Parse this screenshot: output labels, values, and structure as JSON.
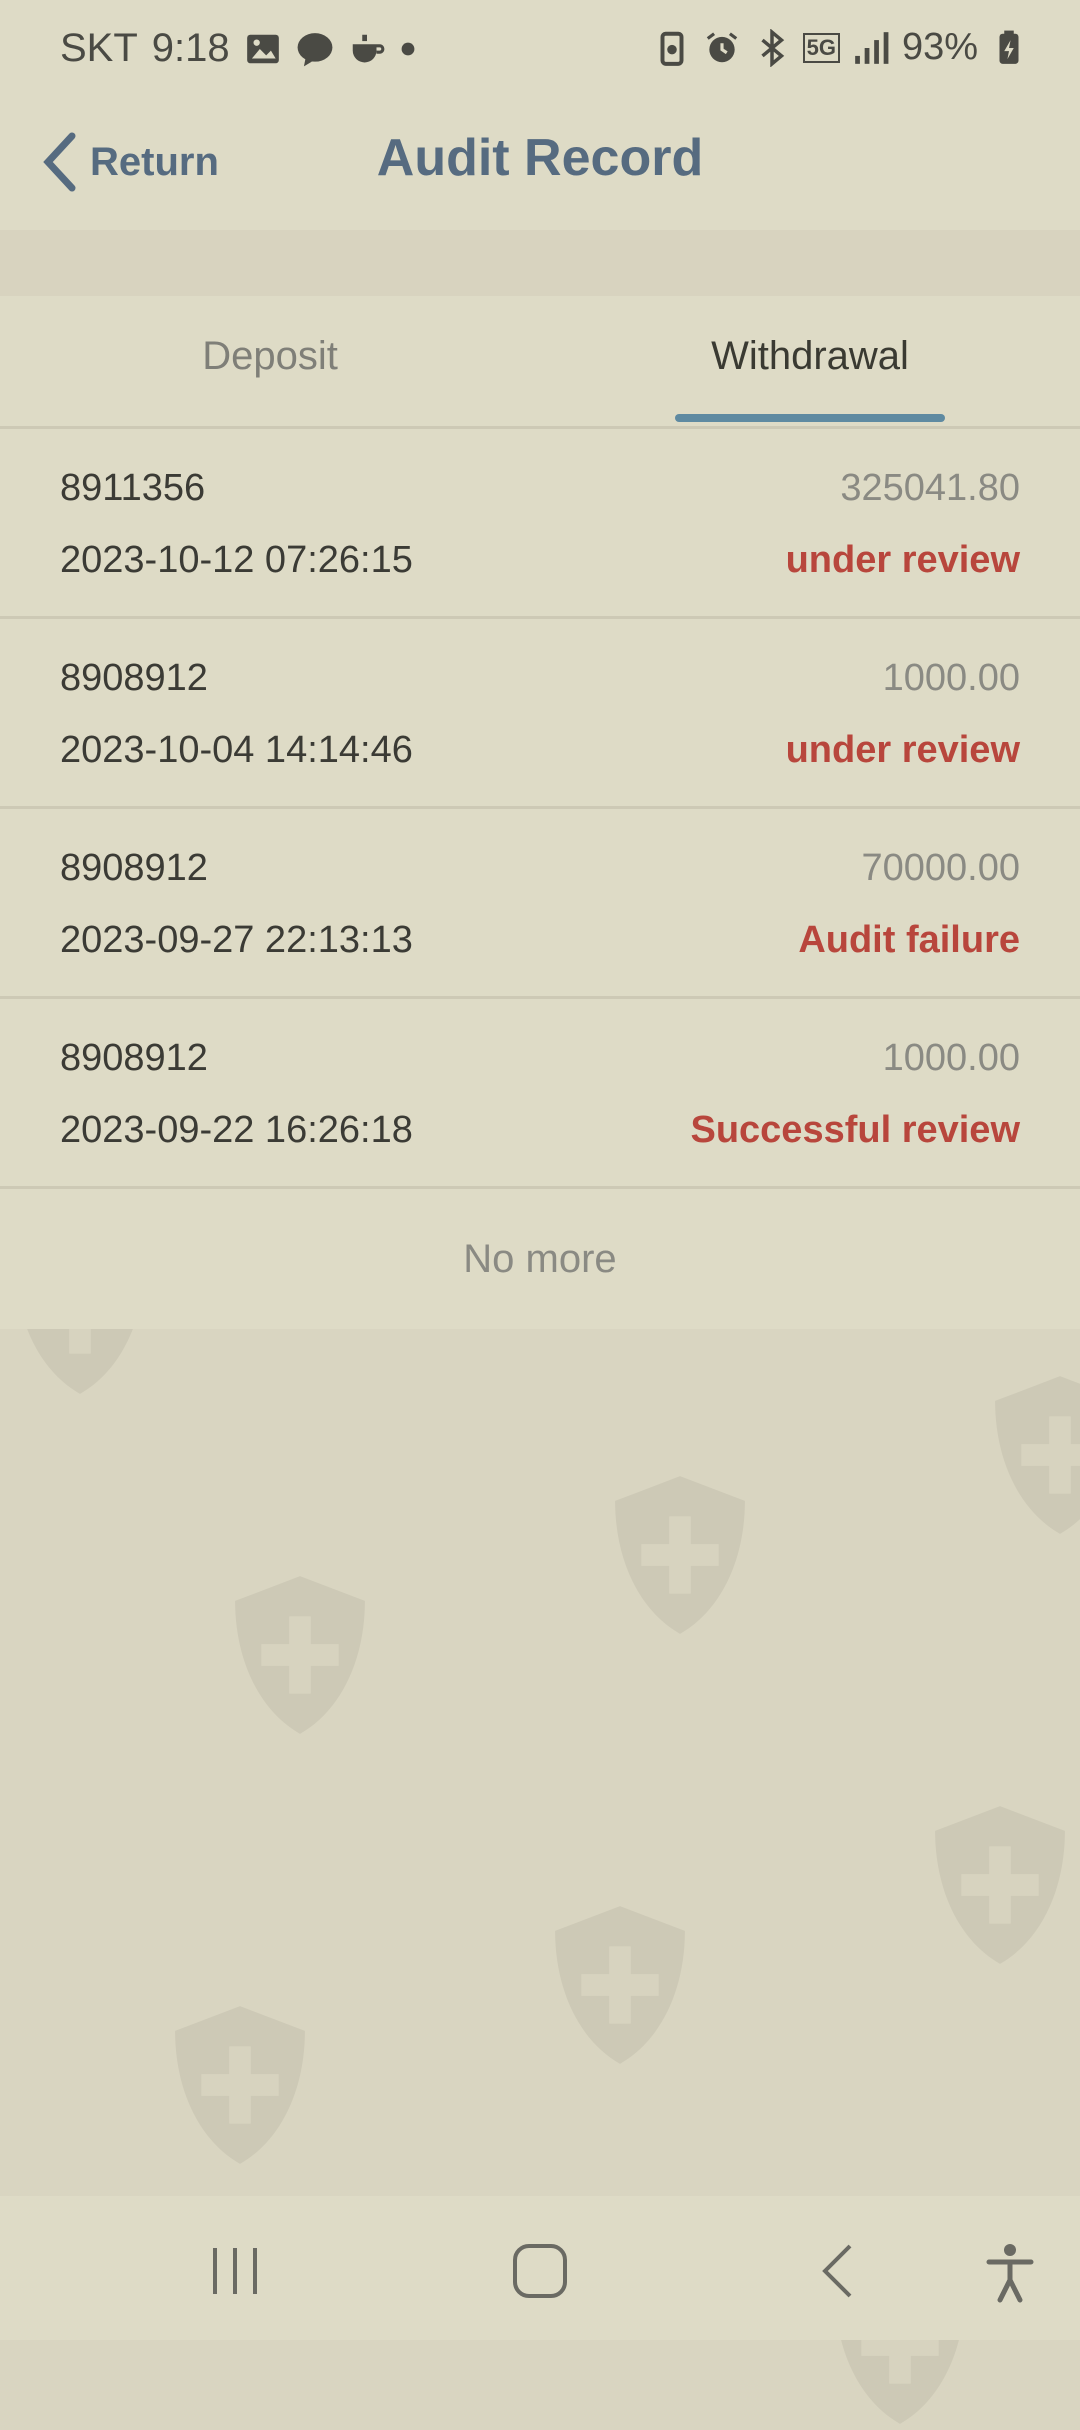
{
  "status_bar": {
    "carrier": "SKT",
    "time": "9:18",
    "battery": "93%",
    "network": "5G"
  },
  "header": {
    "back_label": "Return",
    "title": "Audit Record"
  },
  "tabs": [
    {
      "label": "Deposit",
      "active": false
    },
    {
      "label": "Withdrawal",
      "active": true
    }
  ],
  "records": [
    {
      "id": "8911356",
      "amount": "325041.80",
      "time": "2023-10-12 07:26:15",
      "status": "under review"
    },
    {
      "id": "8908912",
      "amount": "1000.00",
      "time": "2023-10-04 14:14:46",
      "status": "under review"
    },
    {
      "id": "8908912",
      "amount": "70000.00",
      "time": "2023-09-27 22:13:13",
      "status": "Audit failure"
    },
    {
      "id": "8908912",
      "amount": "1000.00",
      "time": "2023-09-22 16:26:18",
      "status": "Successful review"
    }
  ],
  "list_footer": "No more",
  "colors": {
    "accent": "#566b80",
    "status_red": "#b8463c",
    "tab_indicator": "#5f8aa1",
    "background": "#d9d5c1"
  },
  "icons": {
    "back": "chevron-left-icon",
    "nav_recents": "recents-icon",
    "nav_home": "home-icon",
    "nav_back": "back-icon",
    "accessibility": "accessibility-icon",
    "watermark": "shield-cross-icon"
  }
}
